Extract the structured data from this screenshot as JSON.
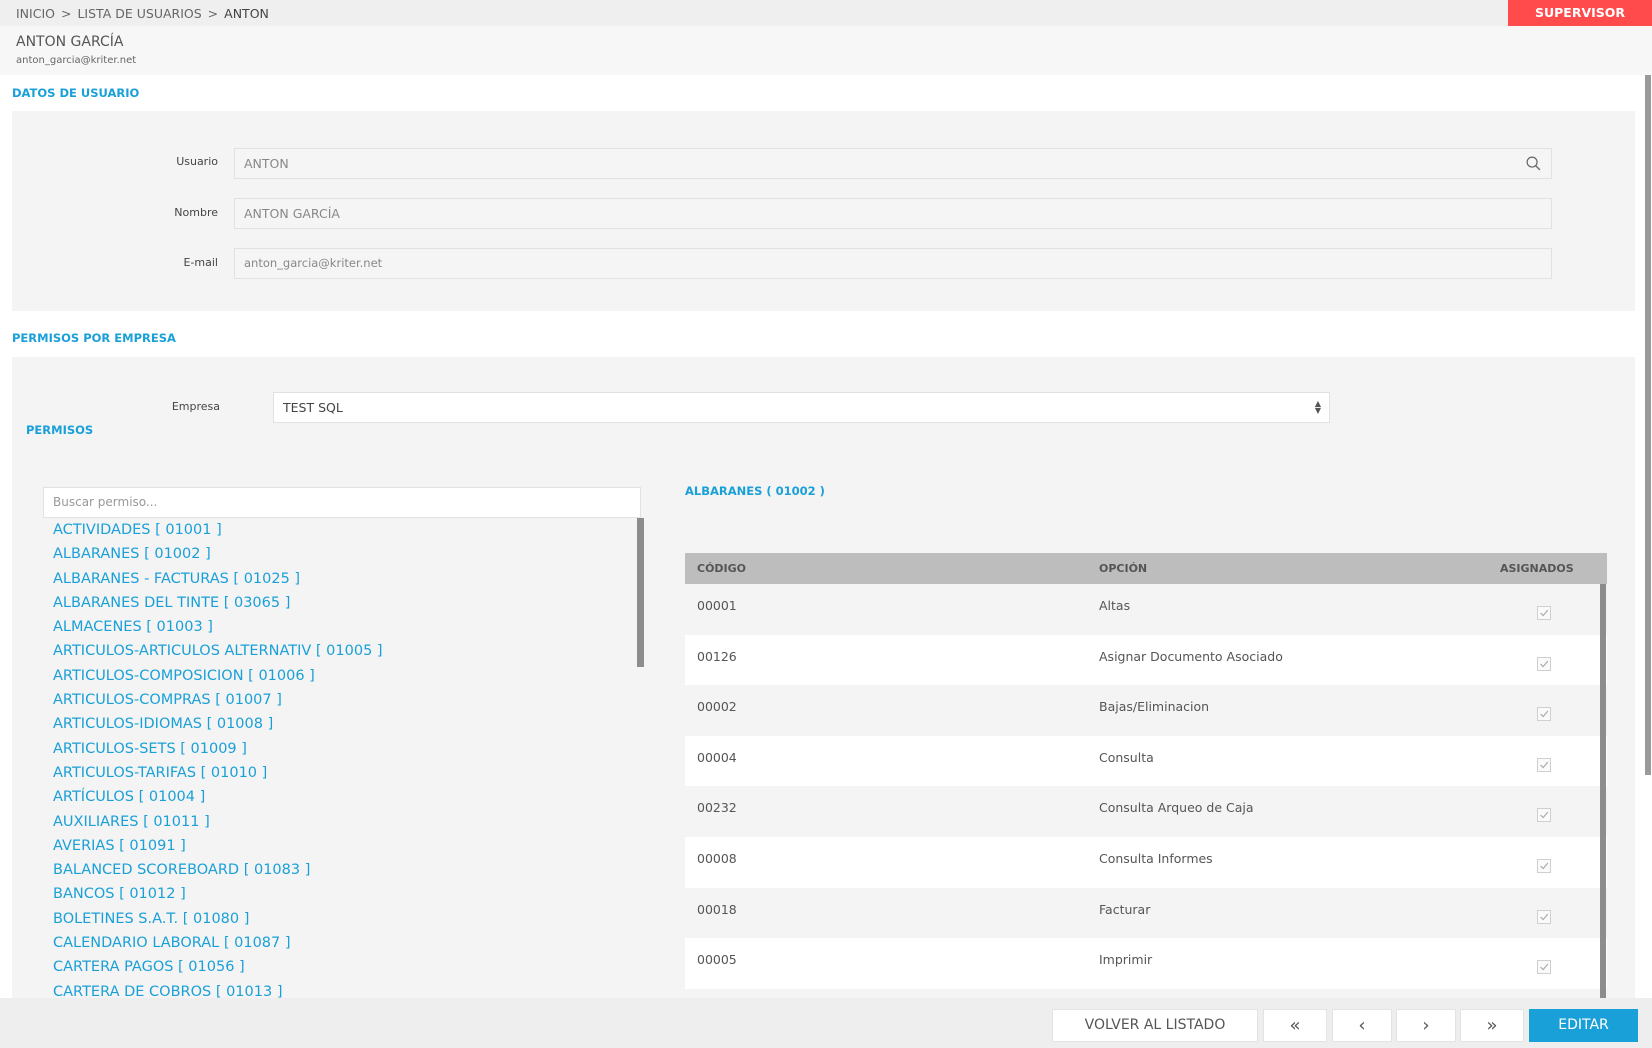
{
  "breadcrumb": {
    "items": [
      {
        "label": "INICIO"
      },
      {
        "label": "LISTA DE USUARIOS"
      },
      {
        "label": "ANTON"
      }
    ],
    "separator": ">"
  },
  "role_badge": "SUPERVISOR",
  "user_header": {
    "name": "ANTON GARCÍA",
    "email": "anton_garcia@kriter.net"
  },
  "user_data": {
    "section_title": "DATOS DE USUARIO",
    "fields": {
      "usuario": {
        "label": "Usuario",
        "value": "ANTON"
      },
      "nombre": {
        "label": "Nombre",
        "value": "ANTON GARCÍA"
      },
      "email": {
        "label": "E-mail",
        "value": "anton_garcia@kriter.net"
      }
    }
  },
  "company_permissions": {
    "section_title": "PERMISOS POR EMPRESA",
    "company_label": "Empresa",
    "company_value": "TEST SQL",
    "permissions_title": "PERMISOS",
    "search_placeholder": "Buscar permiso...",
    "modules": [
      "ACTIVIDADES [ 01001 ]",
      "ALBARANES [ 01002 ]",
      "ALBARANES - FACTURAS [ 01025 ]",
      "ALBARANES DEL TINTE [ 03065 ]",
      "ALMACENES [ 01003 ]",
      "ARTICULOS-ARTICULOS ALTERNATIV [ 01005 ]",
      "ARTICULOS-COMPOSICION [ 01006 ]",
      "ARTICULOS-COMPRAS [ 01007 ]",
      "ARTICULOS-IDIOMAS [ 01008 ]",
      "ARTICULOS-SETS [ 01009 ]",
      "ARTICULOS-TARIFAS [ 01010 ]",
      "ARTÍCULOS [ 01004 ]",
      "AUXILIARES [ 01011 ]",
      "AVERIAS [ 01091 ]",
      "BALANCED SCOREBOARD [ 01083 ]",
      "BANCOS [ 01012 ]",
      "BOLETINES S.A.T. [ 01080 ]",
      "CALENDARIO LABORAL [ 01087 ]",
      "CARTERA PAGOS [ 01056 ]",
      "CARTERA DE COBROS [ 01013 ]"
    ],
    "selected_module_title": "ALBARANES ( 01002 )",
    "table": {
      "headers": {
        "code": "CÓDIGO",
        "option": "OPCIÓN",
        "assigned": "ASIGNADOS"
      },
      "rows": [
        {
          "code": "00001",
          "option": "Altas",
          "assigned": true
        },
        {
          "code": "00126",
          "option": "Asignar Documento Asociado",
          "assigned": true
        },
        {
          "code": "00002",
          "option": "Bajas/Eliminacion",
          "assigned": true
        },
        {
          "code": "00004",
          "option": "Consulta",
          "assigned": true
        },
        {
          "code": "00232",
          "option": "Consulta Arqueo de Caja",
          "assigned": true
        },
        {
          "code": "00008",
          "option": "Consulta Informes",
          "assigned": true
        },
        {
          "code": "00018",
          "option": "Facturar",
          "assigned": true
        },
        {
          "code": "00005",
          "option": "Imprimir",
          "assigned": true
        }
      ]
    }
  },
  "footer": {
    "back_label": "VOLVER AL LISTADO",
    "first_label": "«",
    "prev_label": "‹",
    "next_label": "›",
    "last_label": "»",
    "edit_label": "EDITAR"
  },
  "colors": {
    "accent": "#1aa0d8",
    "badge": "#ff4b4b"
  }
}
